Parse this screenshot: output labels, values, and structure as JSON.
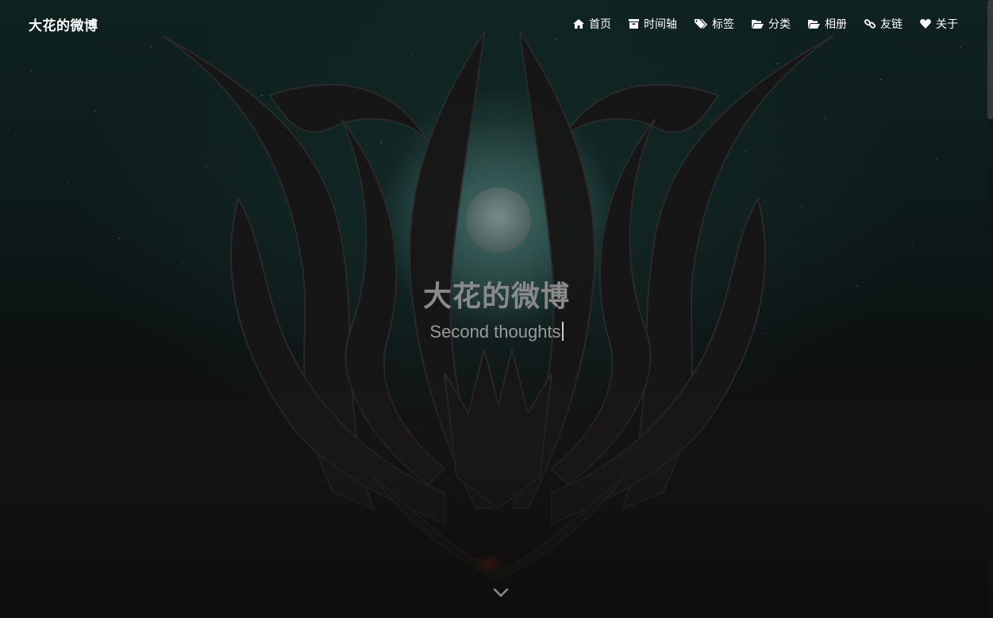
{
  "navbar": {
    "brand": "大花的微博",
    "items": [
      {
        "label": "首页",
        "icon": "home-icon"
      },
      {
        "label": "时间轴",
        "icon": "archive-icon"
      },
      {
        "label": "标签",
        "icon": "tags-icon"
      },
      {
        "label": "分类",
        "icon": "folder-open-icon"
      },
      {
        "label": "相册",
        "icon": "folder-open-icon"
      },
      {
        "label": "友链",
        "icon": "link-icon"
      },
      {
        "label": "关于",
        "icon": "heart-icon"
      }
    ]
  },
  "hero": {
    "title": "大花的微博",
    "subtitle": "Second thoughts",
    "scroll_icon": "chevron-down-icon"
  },
  "colors": {
    "text": "#ffffff",
    "title": "#8a8a8a",
    "background": "#0d1a19"
  }
}
